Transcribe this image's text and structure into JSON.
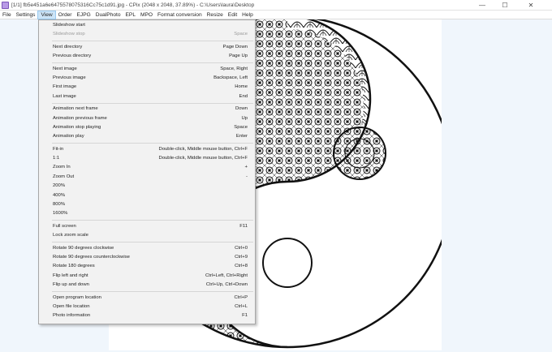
{
  "window": {
    "title": "[1/1] fb5e451a6e6475578075316Cc75c1d91.jpg - CPix (2048 x 2048, 37.89%) - C:\\Users\\laura\\Desktop",
    "controls": {
      "minimize": "—",
      "maximize": "☐",
      "close": "✕"
    }
  },
  "menubar": {
    "items": [
      "File",
      "Settings",
      "View",
      "Order",
      "EJPG",
      "DualPhoto",
      "EPL",
      "MPO",
      "Format conversion",
      "Resize",
      "Edit",
      "Help"
    ],
    "active": "View"
  },
  "view_menu": {
    "groups": [
      [
        {
          "label": "Slideshow start",
          "shortcut": "",
          "disabled": false
        },
        {
          "label": "Slideshow stop",
          "shortcut": "Space",
          "disabled": true
        }
      ],
      [
        {
          "label": "Next directory",
          "shortcut": "Page Down",
          "disabled": false
        },
        {
          "label": "Previous directory",
          "shortcut": "Page Up",
          "disabled": false
        }
      ],
      [
        {
          "label": "Next image",
          "shortcut": "Space, Right",
          "disabled": false
        },
        {
          "label": "Previous image",
          "shortcut": "Backspace, Left",
          "disabled": false
        },
        {
          "label": "First image",
          "shortcut": "Home",
          "disabled": false
        },
        {
          "label": "Last image",
          "shortcut": "End",
          "disabled": false
        }
      ],
      [
        {
          "label": "Animation next frame",
          "shortcut": "Down",
          "disabled": false
        },
        {
          "label": "Animation previous frame",
          "shortcut": "Up",
          "disabled": false
        },
        {
          "label": "Animation stop playing",
          "shortcut": "Space",
          "disabled": false
        },
        {
          "label": "Animation play",
          "shortcut": "Enter",
          "disabled": false
        }
      ],
      [
        {
          "label": "Fit-in",
          "shortcut": "Double-click, Middle mouse button, Ctrl+F",
          "disabled": false
        },
        {
          "label": "1:1",
          "shortcut": "Double-click, Middle mouse button, Ctrl+F",
          "disabled": false
        },
        {
          "label": "Zoom In",
          "shortcut": "+",
          "disabled": false
        },
        {
          "label": "Zoom Out",
          "shortcut": "-",
          "disabled": false
        },
        {
          "label": "200%",
          "shortcut": "",
          "disabled": false
        },
        {
          "label": "400%",
          "shortcut": "",
          "disabled": false
        },
        {
          "label": "800%",
          "shortcut": "",
          "disabled": false
        },
        {
          "label": "1600%",
          "shortcut": "",
          "disabled": false
        }
      ],
      [
        {
          "label": "Full screen",
          "shortcut": "F11",
          "disabled": false
        },
        {
          "label": "Lock zoom scale",
          "shortcut": "",
          "disabled": false
        }
      ],
      [
        {
          "label": "Rotate 90 degrees clockwise",
          "shortcut": "Ctrl+0",
          "disabled": false
        },
        {
          "label": "Rotate 90 degrees counterclockwise",
          "shortcut": "Ctrl+9",
          "disabled": false
        },
        {
          "label": "Rotate 180 degrees",
          "shortcut": "Ctrl+8",
          "disabled": false
        },
        {
          "label": "Flip left and right",
          "shortcut": "Ctrl+Left, Ctrl+Right",
          "disabled": false
        },
        {
          "label": "Flip up and down",
          "shortcut": "Ctrl+Up, Ctrl+Down",
          "disabled": false
        }
      ],
      [
        {
          "label": "Open program location",
          "shortcut": "Ctrl+P",
          "disabled": false
        },
        {
          "label": "Open file location",
          "shortcut": "Ctrl+L",
          "disabled": false
        },
        {
          "label": "Photo information",
          "shortcut": "F1",
          "disabled": false
        }
      ]
    ]
  },
  "colors": {
    "menu_active_bg": "#cce4f7",
    "title_icon": "#b89ae6",
    "canvas_bg": "#f0f6fc"
  }
}
